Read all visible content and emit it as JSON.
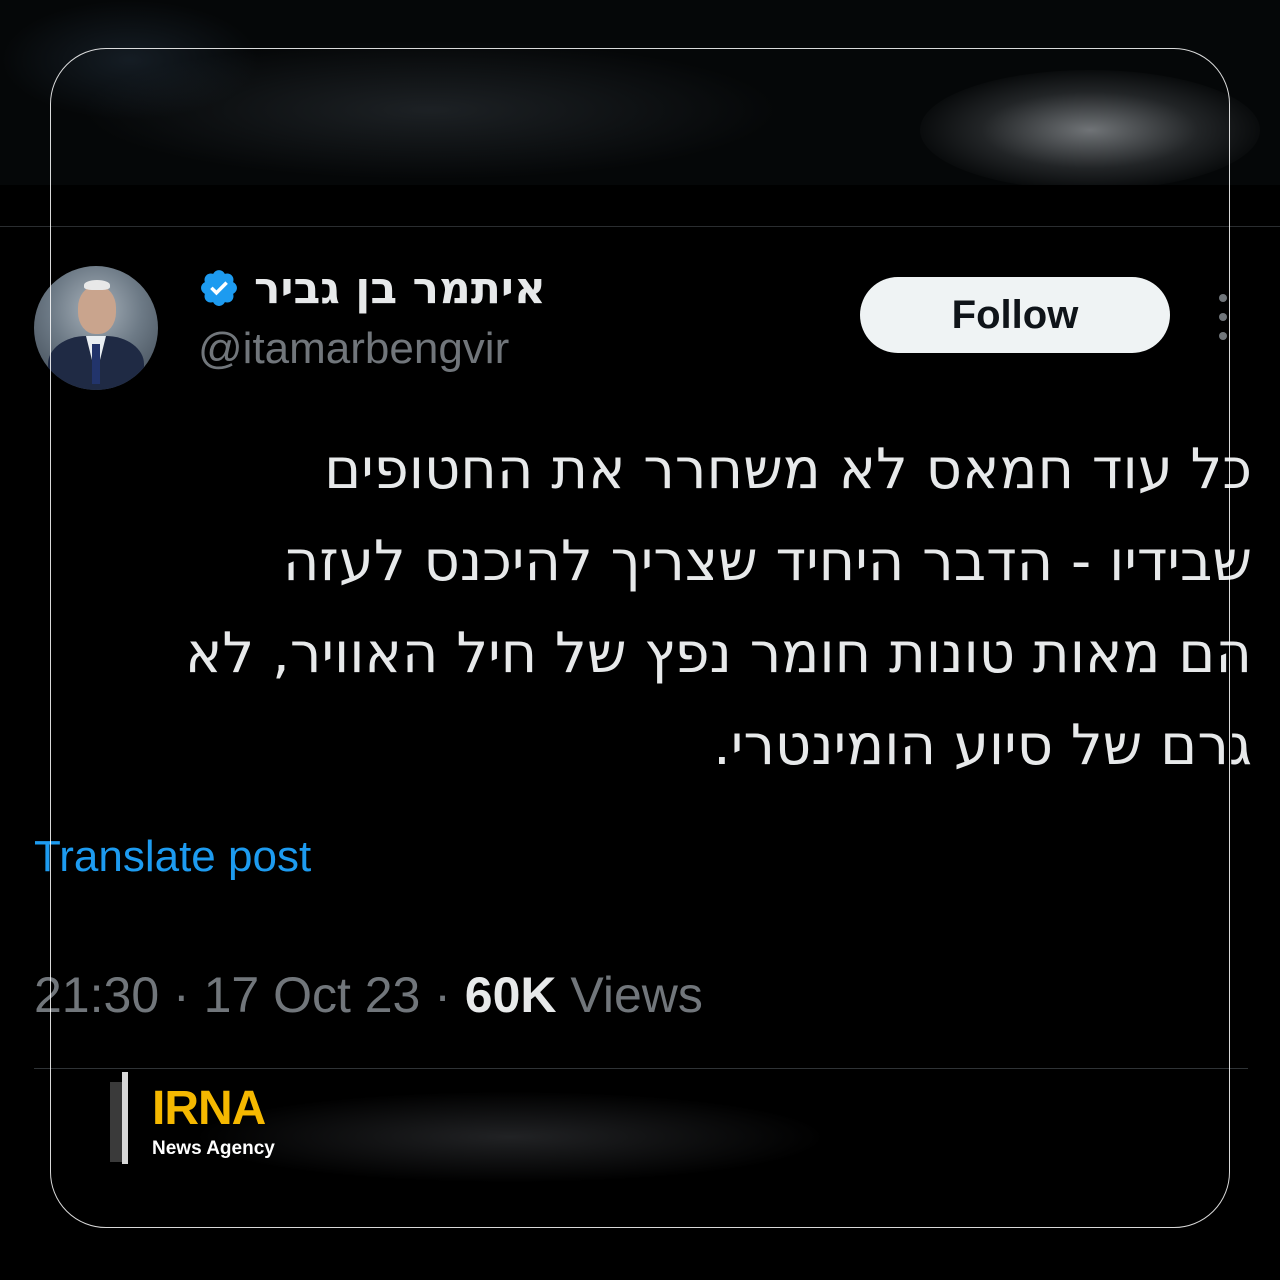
{
  "author": {
    "display_name": "איתמר בן גביר",
    "handle": "@itamarbengvir",
    "verified_icon": "verified-badge-icon"
  },
  "actions": {
    "follow_label": "Follow",
    "more_icon": "more-options-icon"
  },
  "tweet": {
    "lines": [
      "כל עוד חמאס לא משחרר את החטופים",
      "שבידיו -  הדבר היחיד שצריך להיכנס לעזה",
      "הם מאות טונות חומר נפץ של חיל האוויר, לא",
      "גרם של סיוע הומינטרי."
    ],
    "translate_label": "Translate post"
  },
  "meta": {
    "time": "21:30",
    "separator": " · ",
    "date": "17 Oct 23",
    "views_count": "60K",
    "views_label": " Views"
  },
  "watermark": {
    "brand": "IRNA",
    "subtitle": "News Agency"
  },
  "colors": {
    "background": "#000000",
    "text": "#e7e9ea",
    "muted": "#71767b",
    "link": "#1d9bf0",
    "verified": "#1d9bf0",
    "follow_bg": "#eff3f4",
    "irna_gold": "#f5b800"
  }
}
